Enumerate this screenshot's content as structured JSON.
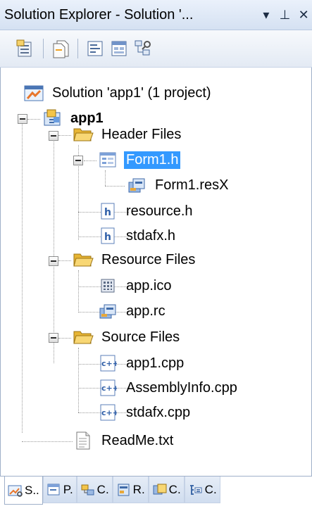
{
  "window": {
    "title": "Solution Explorer - Solution '...",
    "dropdown_glyph": "▾",
    "pin_glyph": "⊥",
    "close_glyph": "✕"
  },
  "toolbar": {
    "buttons": [
      {
        "icon": "properties-icon"
      },
      {
        "icon": "show-all-files-icon"
      },
      {
        "icon": "view-code-icon"
      },
      {
        "icon": "view-designer-icon"
      },
      {
        "icon": "class-view-icon"
      }
    ]
  },
  "tree": {
    "solution": "Solution 'app1' (1 project)",
    "project": "app1",
    "header_folder": "Header Files",
    "form1_h": "Form1.h",
    "form1_resx": "Form1.resX",
    "resource_h": "resource.h",
    "stdafx_h": "stdafx.h",
    "resource_folder": "Resource Files",
    "app_ico": "app.ico",
    "app_rc": "app.rc",
    "source_folder": "Source Files",
    "app1_cpp": "app1.cpp",
    "assemblyinfo_cpp": "AssemblyInfo.cpp",
    "stdafx_cpp": "stdafx.cpp",
    "readme_txt": "ReadMe.txt"
  },
  "tabs": [
    {
      "label": "S..",
      "icon": "solution-explorer-icon"
    },
    {
      "label": "P.",
      "icon": "property-manager-icon"
    },
    {
      "label": "C.",
      "icon": "class-view-icon"
    },
    {
      "label": "R.",
      "icon": "resource-view-icon"
    },
    {
      "label": "C.",
      "icon": "code-definition-icon"
    },
    {
      "label": "C.",
      "icon": "call-browser-icon"
    }
  ],
  "colors": {
    "selection": "#3399ff",
    "folder": "#f2c14e",
    "titlebar": "#d5e1f2"
  }
}
